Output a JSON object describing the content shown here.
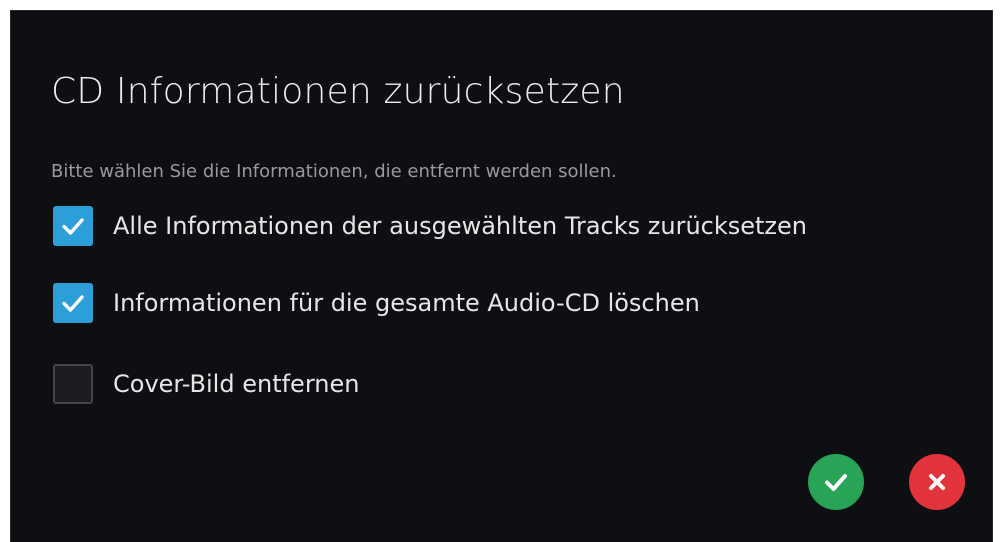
{
  "dialog": {
    "title": "CD Informationen zurücksetzen",
    "subtitle": "Bitte wählen Sie die Informationen, die entfernt werden sollen."
  },
  "options": [
    {
      "label": "Alle Informationen der ausgewählten Tracks zurücksetzen",
      "checked": true
    },
    {
      "label": "Informationen für die gesamte Audio-CD löschen",
      "checked": true
    },
    {
      "label": "Cover-Bild entfernen",
      "checked": false
    }
  ],
  "buttons": {
    "confirm_icon": "check-icon",
    "cancel_icon": "close-icon"
  },
  "colors": {
    "background": "#0e0f12",
    "accent": "#2c9fd9",
    "confirm": "#27a455",
    "cancel": "#e3343d"
  }
}
